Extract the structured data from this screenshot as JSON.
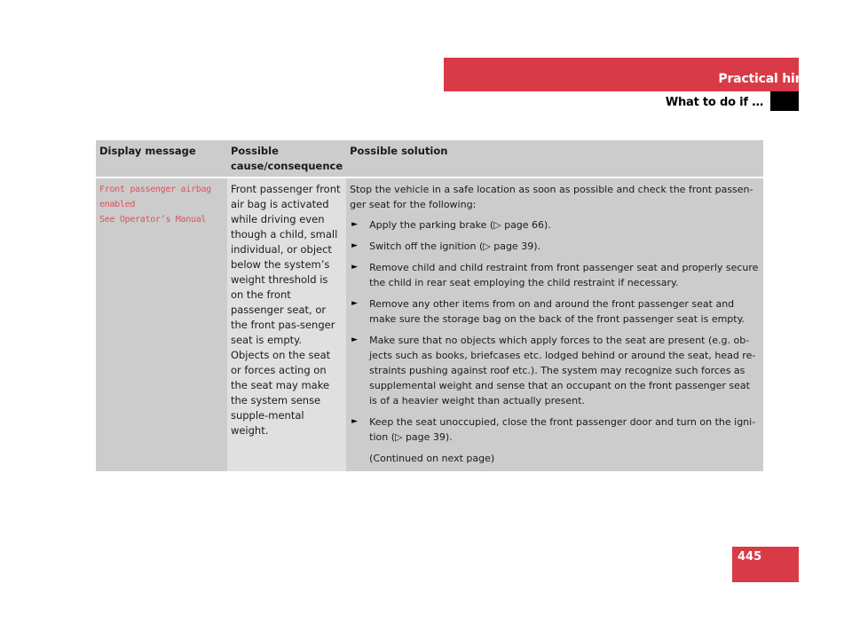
{
  "header": {
    "section_title": "Practical hints",
    "subsection_title": "What to do if …",
    "accent_color": "#d93a47"
  },
  "table": {
    "columns": [
      "Display message",
      "Possible cause/consequence",
      "Possible solution"
    ],
    "rows": [
      {
        "display_message_lines": [
          "Front passenger airbag",
          "enabled",
          "See Operator’s Manual"
        ],
        "cause": "Front passenger front air bag is activated while driving even though a child, small individual, or object below the system’s weight threshold is on the front passenger seat, or the front pas-senger seat is empty. Objects on the seat or forces acting on the seat may make the system sense supple-mental weight.",
        "solution": {
          "intro": "Stop the vehicle in a safe location as soon as possible and check the front passen-ger seat for the following:",
          "steps": [
            "Apply the parking brake (▷ page 66).",
            "Switch off the ignition (▷ page 39).",
            "Remove child and child restraint from front passenger seat and properly secure the child in rear seat employing the child restraint if necessary.",
            "Remove any other items from on and around the front passenger seat and make sure the storage bag on the back of the front passenger seat is empty.",
            "Make sure that no objects which apply forces to the seat are present (e.g. ob-jects such as books, briefcases etc. lodged behind or around the seat, head re-straints pushing against roof etc.). The system may recognize such forces as supplemental weight and sense that an occupant on the front passenger seat is of a heavier weight than actually present.",
            "Keep the seat unoccupied, close the front passenger door and turn on the igni-tion (▷ page 39)."
          ],
          "continued": "(Continued on next page)"
        }
      }
    ]
  },
  "icons": {
    "bullet": "►"
  },
  "footer": {
    "page_number": "445"
  }
}
